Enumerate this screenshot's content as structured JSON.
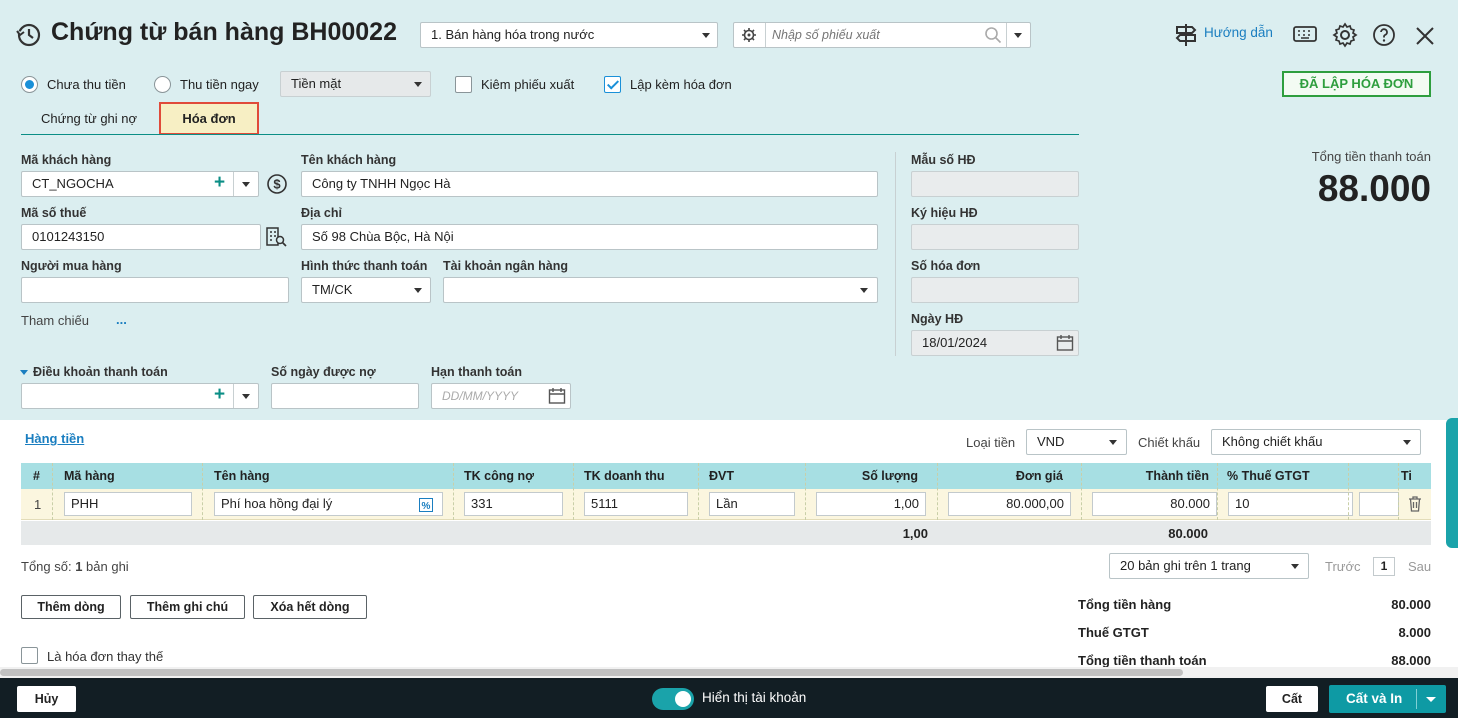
{
  "header": {
    "title": "Chứng từ bán hàng BH00022",
    "type_select": "1. Bán hàng hóa trong nước",
    "search_placeholder": "Nhập số phiếu xuất",
    "guide": "Hướng dẫn"
  },
  "options": {
    "radio_unpaid": "Chưa thu tiền",
    "radio_paid": "Thu tiền ngay",
    "payment_method": "Tiền mặt",
    "chk_export": "Kiêm phiếu xuất",
    "chk_invoice": "Lập kèm hóa đơn",
    "invoice_badge": "ĐÃ LẬP HÓA ĐƠN"
  },
  "tabs": [
    {
      "label": "Chứng từ ghi nợ"
    },
    {
      "label": "Hóa đơn"
    }
  ],
  "form": {
    "customer_code_label": "Mã khách hàng",
    "customer_code": "CT_NGOCHA",
    "customer_name_label": "Tên khách hàng",
    "customer_name": "Công ty TNHH Ngọc Hà",
    "tax_code_label": "Mã số thuế",
    "tax_code": "0101243150",
    "address_label": "Địa chỉ",
    "address": "Số 98 Chùa Bộc, Hà Nội",
    "buyer_label": "Người mua hàng",
    "buyer": "",
    "payment_form_label": "Hình thức thanh toán",
    "payment_form": "TM/CK",
    "bank_label": "Tài khoản ngân hàng",
    "bank": "",
    "reference_label": "Tham chiếu",
    "reference_more": "...",
    "terms_label": "Điều khoản thanh toán",
    "terms": "",
    "days_label": "Số ngày được nợ",
    "days": "",
    "due_label": "Hạn thanh toán",
    "due_placeholder": "DD/MM/YYYY"
  },
  "invoice": {
    "form_no_label": "Mẫu số HĐ",
    "form_no": "",
    "symbol_label": "Ký hiệu HĐ",
    "symbol": "",
    "number_label": "Số hóa đơn",
    "number": "",
    "date_label": "Ngày HĐ",
    "date": "18/01/2024"
  },
  "total": {
    "label": "Tổng tiền thanh toán",
    "value": "88.000"
  },
  "grid": {
    "tab_label": "Hàng tiền",
    "currency_label": "Loại tiền",
    "currency": "VND",
    "discount_label": "Chiết khấu",
    "discount": "Không chiết khấu",
    "columns": [
      "#",
      "Mã hàng",
      "Tên hàng",
      "TK công nợ",
      "TK doanh thu",
      "ĐVT",
      "Số lượng",
      "Đơn giá",
      "Thành tiền",
      "% Thuế GTGT",
      "Ti"
    ],
    "rows": [
      {
        "no": "1",
        "code": "PHH",
        "name": "Phí hoa hồng đại lý",
        "debit_acc": "331",
        "revenue_acc": "5111",
        "unit": "Lần",
        "qty": "1,00",
        "price": "80.000,00",
        "amount": "80.000",
        "vat": "10",
        "extra": ""
      }
    ],
    "sum_qty": "1,00",
    "sum_amount": "80.000"
  },
  "paging": {
    "total_prefix": "Tổng số: ",
    "total_count": "1",
    "total_suffix": " bản ghi",
    "per_page": "20 bản ghi trên 1 trang",
    "prev": "Trước",
    "page": "1",
    "next": "Sau"
  },
  "actions": {
    "add_row": "Thêm dòng",
    "add_note": "Thêm ghi chú",
    "clear_rows": "Xóa hết dòng",
    "replace_invoice": "Là hóa đơn thay thế"
  },
  "summary": [
    {
      "label": "Tổng tiền hàng",
      "value": "80.000"
    },
    {
      "label": "Thuế GTGT",
      "value": "8.000"
    },
    {
      "label": "Tổng tiền thanh toán",
      "value": "88.000"
    }
  ],
  "footer": {
    "cancel": "Hủy",
    "show_account": "Hiển thị tài khoản",
    "save": "Cất",
    "save_print": "Cất và In"
  },
  "colors": {
    "accent": "#0b8e86",
    "header_bg": "#dbeef0",
    "grid_header": "#a7dfe3",
    "footer": "#121e24",
    "badge": "#2e9e3e",
    "tab_highlight": "#f7efc4"
  }
}
